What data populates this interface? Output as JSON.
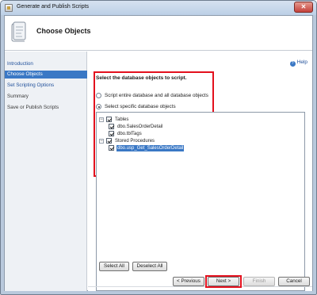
{
  "window": {
    "title": "Generate and Publish Scripts",
    "close_glyph": "✕"
  },
  "header": {
    "title": "Choose Objects"
  },
  "sidebar": {
    "items": [
      {
        "label": "Introduction",
        "state": "link"
      },
      {
        "label": "Choose Objects",
        "state": "active"
      },
      {
        "label": "Set Scripting Options",
        "state": "link"
      },
      {
        "label": "Summary",
        "state": "normal"
      },
      {
        "label": "Save or Publish Scripts",
        "state": "normal"
      }
    ]
  },
  "main": {
    "help_label": "Help",
    "help_glyph": "?",
    "instruction": "Select the database objects to script.",
    "radio_all": "Script entire database and all database objects",
    "radio_specific": "Select specific database objects",
    "radio_selected": "specific",
    "tree": {
      "tables_label": "Tables",
      "table_items": [
        "dbo.SalesOrderDetail",
        "dbo.tblTags"
      ],
      "procs_label": "Stored Procedures",
      "proc_items": [
        "dbo.usp_Get_SalesOrderDetail"
      ],
      "expander_glyph": "−"
    },
    "select_all": "Select All",
    "deselect_all": "Deselect All"
  },
  "footer": {
    "previous": "< Previous",
    "next": "Next >",
    "finish": "Finish",
    "cancel": "Cancel"
  },
  "colors": {
    "accent": "#3a78c5",
    "highlight": "#e3101d"
  }
}
